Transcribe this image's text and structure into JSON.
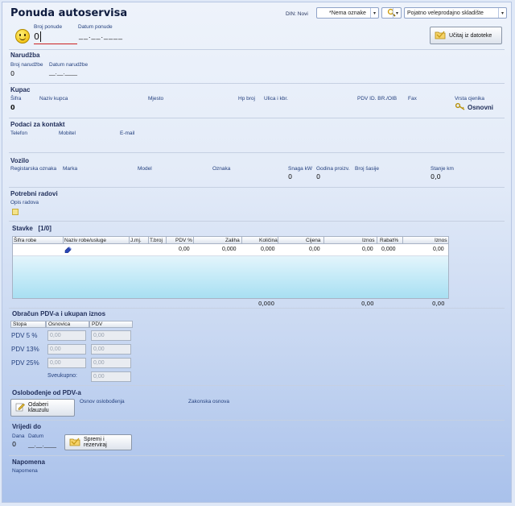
{
  "header": {
    "title": "Ponuda autoservisa",
    "din_label": "DIN: Novi",
    "tag_select": "*Nema oznake",
    "warehouse_select": "Pojatno veleprodajno skladište",
    "load_button": "Učitaj iz datoteke",
    "broj_ponude_label": "Broj ponude",
    "broj_ponude_value": "0",
    "datum_ponude_label": "Datum ponude",
    "datum_ponude_value": "__.__.____"
  },
  "narudzba": {
    "title": "Narudžba",
    "broj_label": "Broj narudžbe",
    "broj_value": "0",
    "datum_label": "Datum narudžbe",
    "datum_value": "__.__.____"
  },
  "kupac": {
    "title": "Kupac",
    "labels": [
      "Šifra",
      "Naziv kupca",
      "Mjesto",
      "Hp broj",
      "Ulica i kbr.",
      "PDV ID. BR./OIB",
      "Fax",
      "Vrsta cjenika"
    ],
    "sifra_value": "0",
    "vrsta_cjenika_value": "Osnovni"
  },
  "kontakt": {
    "title": "Podaci za kontakt",
    "labels": [
      "Telefon",
      "Mobitel",
      "E-mail"
    ]
  },
  "vozilo": {
    "title": "Vozilo",
    "labels": [
      "Registarska oznaka",
      "Marka",
      "Model",
      "Oznaka",
      "Snaga kW",
      "Godina proizv.",
      "Broj šasije",
      "Stanje km"
    ],
    "snaga_value": "0",
    "godina_value": "0",
    "stanje_value": "0,0"
  },
  "radovi": {
    "title": "Potrebni radovi",
    "opis_label": "Opis radova"
  },
  "stavke": {
    "title": "Stavke",
    "count": "[1/0]",
    "columns": [
      "Šifra robe",
      "Naziv robe/usluge",
      "J.mj.",
      "T.broj",
      "PDV %",
      "Zaliha",
      "Količina",
      "Cijena",
      "Iznos",
      "Rabat%",
      "Iznos"
    ],
    "row": [
      "",
      "",
      "",
      "",
      "0,00",
      "0,000",
      "0,000",
      "0,00",
      "0,00",
      "0,000",
      "0,00"
    ],
    "totals": {
      "kolicina": "0,000",
      "iznos": "0,00",
      "iznos2": "0,00"
    }
  },
  "obracun": {
    "title": "Obračun PDV-a i ukupan iznos",
    "columns": [
      "Stopa",
      "Osnovica",
      "PDV"
    ],
    "rows": [
      {
        "label": "PDV 5 %",
        "osnovica": "0,00",
        "pdv": "0,00"
      },
      {
        "label": "PDV 13%",
        "osnovica": "0,00",
        "pdv": "0,00"
      },
      {
        "label": "PDV 25%",
        "osnovica": "0,00",
        "pdv": "0,00"
      }
    ],
    "sveukupno_label": "Sveukupno:",
    "sveukupno_value": "0,00"
  },
  "oslobodjenje": {
    "title": "Oslobođenje od PDV-a",
    "button": "Odaberi klauzulu",
    "osnov_label": "Osnov oslobođenja",
    "zakonska_label": "Zakonska osnova"
  },
  "vrijedi": {
    "title": "Vrijedi do",
    "dana_label": "Dana",
    "datum_label": "Datum",
    "dana_value": "0",
    "datum_value": "__.__.____",
    "button": "Spremi i rezerviraj"
  },
  "napomena": {
    "title": "Napomena",
    "label": "Napomena"
  },
  "icons": {
    "smiley": "smiley-icon",
    "search": "magnifier-icon",
    "load": "folder-icon",
    "key": "key-icon",
    "notes": "note-icon"
  }
}
